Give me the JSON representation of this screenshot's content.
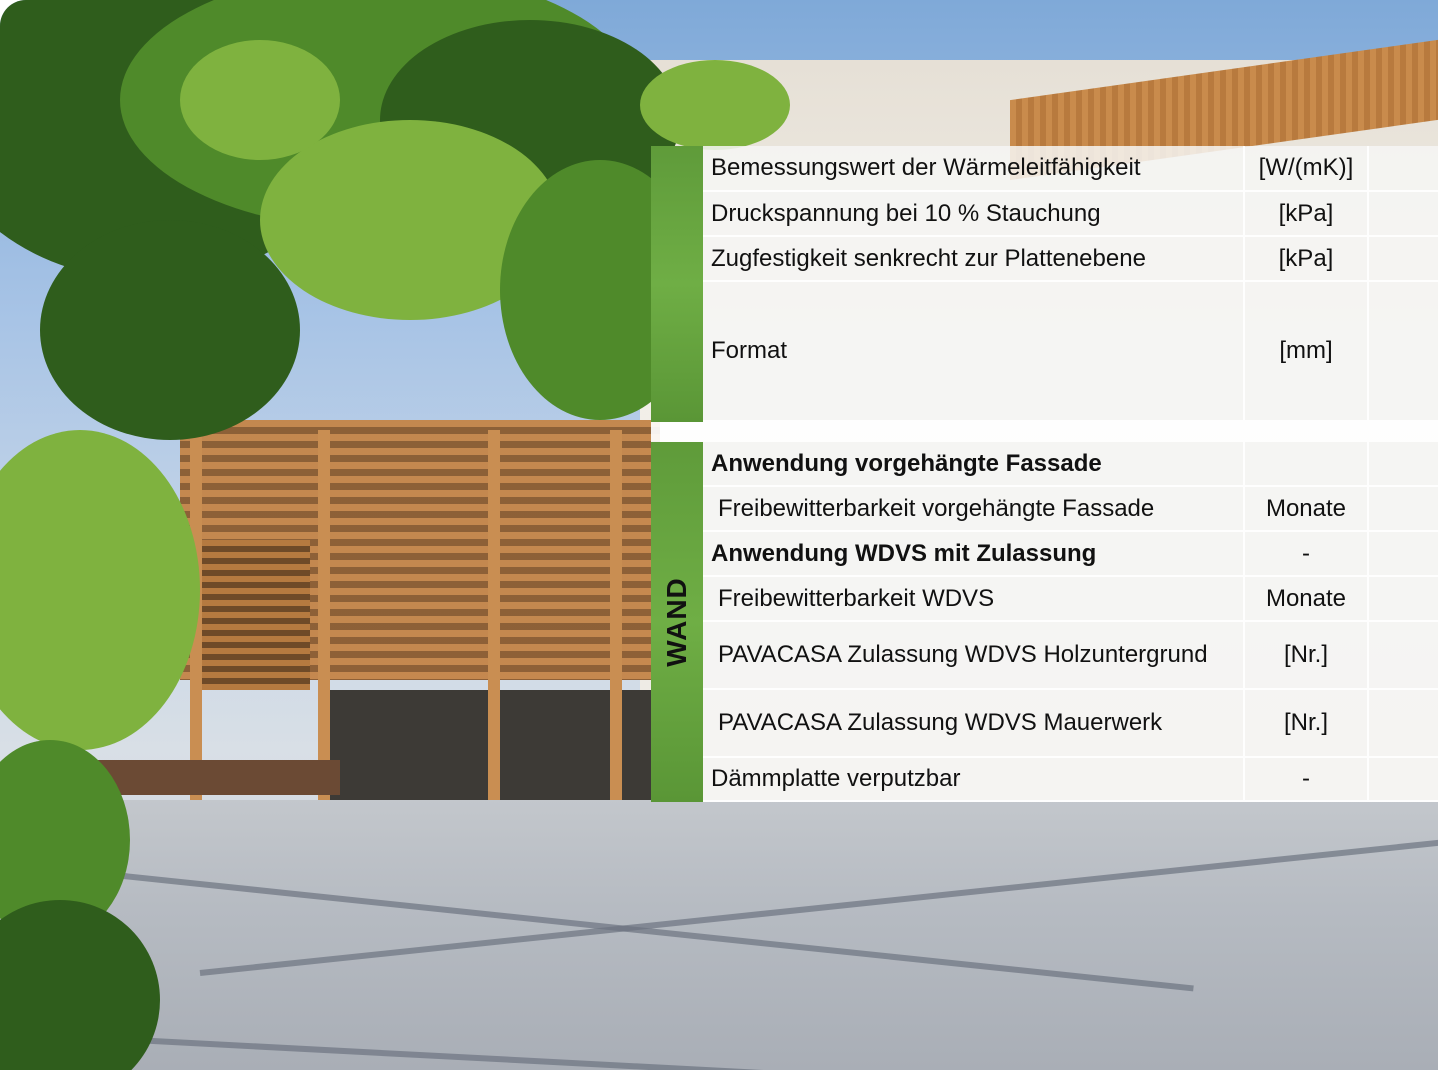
{
  "colors": {
    "accent_green": "#6fae45",
    "table_bg": "#f6f6f4"
  },
  "table": {
    "side_label": "WAND",
    "rows": [
      {
        "label": "Bemessungswert der Wärmeleitfähigkeit",
        "unit": "[W/(mK)]"
      },
      {
        "label": "Druckspannung bei 10 % Stauchung",
        "unit": "[kPa]"
      },
      {
        "label": "Zugfestigkeit senkrecht zur Plattenebene",
        "unit": "[kPa]"
      },
      {
        "label": "Format",
        "unit": "[mm]"
      }
    ],
    "wand_rows": [
      {
        "label": "Anwendung vorgehängte Fassade",
        "unit": ""
      },
      {
        "label": "Freibewitterbarkeit vorgehängte Fassade",
        "unit": "Monate"
      },
      {
        "label": "Anwendung WDVS mit Zulassung",
        "unit": "-"
      },
      {
        "label": "Freibewitterbarkeit WDVS",
        "unit": "Monate"
      },
      {
        "label": "PAVACASA Zulassung WDVS Holzuntergrund",
        "unit": "[Nr.]"
      },
      {
        "label": "PAVACASA Zulassung WDVS Mauerwerk",
        "unit": "[Nr.]"
      },
      {
        "label": "Dämmplatte verputzbar",
        "unit": "-"
      }
    ]
  }
}
